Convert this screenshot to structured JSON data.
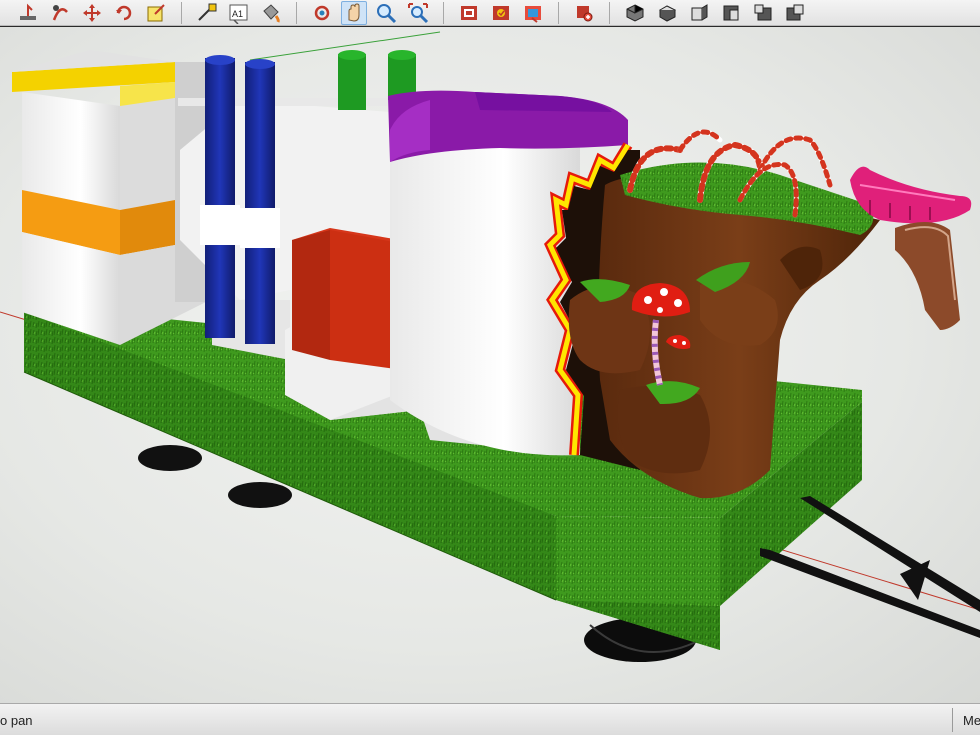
{
  "toolbar": {
    "groups": [
      {
        "buttons": [
          {
            "icon": "position-camera-icon"
          },
          {
            "icon": "walk-icon"
          },
          {
            "icon": "move-icon"
          },
          {
            "icon": "rotate-icon"
          },
          {
            "icon": "scale-icon"
          }
        ]
      },
      {
        "buttons": [
          {
            "icon": "tape-measure-icon"
          },
          {
            "icon": "text-icon",
            "label": "A1"
          },
          {
            "icon": "paint-bucket-icon"
          }
        ]
      },
      {
        "buttons": [
          {
            "icon": "orbit-icon"
          },
          {
            "icon": "pan-icon",
            "active": true
          },
          {
            "icon": "zoom-icon"
          },
          {
            "icon": "zoom-extents-icon"
          }
        ]
      },
      {
        "buttons": [
          {
            "icon": "get-models-icon"
          },
          {
            "icon": "share-model-icon"
          },
          {
            "icon": "share-component-icon"
          }
        ]
      },
      {
        "buttons": [
          {
            "icon": "extension-warehouse-icon"
          }
        ]
      },
      {
        "buttons": [
          {
            "icon": "iso-view-icon"
          },
          {
            "icon": "top-view-icon"
          },
          {
            "icon": "front-view-icon"
          },
          {
            "icon": "right-view-icon"
          },
          {
            "icon": "back-view-icon"
          },
          {
            "icon": "left-view-icon"
          }
        ]
      }
    ]
  },
  "status": {
    "hint": "o pan",
    "measure_label": "Me"
  },
  "colors": {
    "grass": "#3f9a1e",
    "trunk": "#6b3414",
    "purple": "#8a1aa8",
    "blue": "#1a2ea0",
    "red": "#c22b10",
    "yellow": "#ffe600",
    "orange": "#f59c12",
    "stack_green": "#1e9a22",
    "magenta": "#e0207a"
  }
}
